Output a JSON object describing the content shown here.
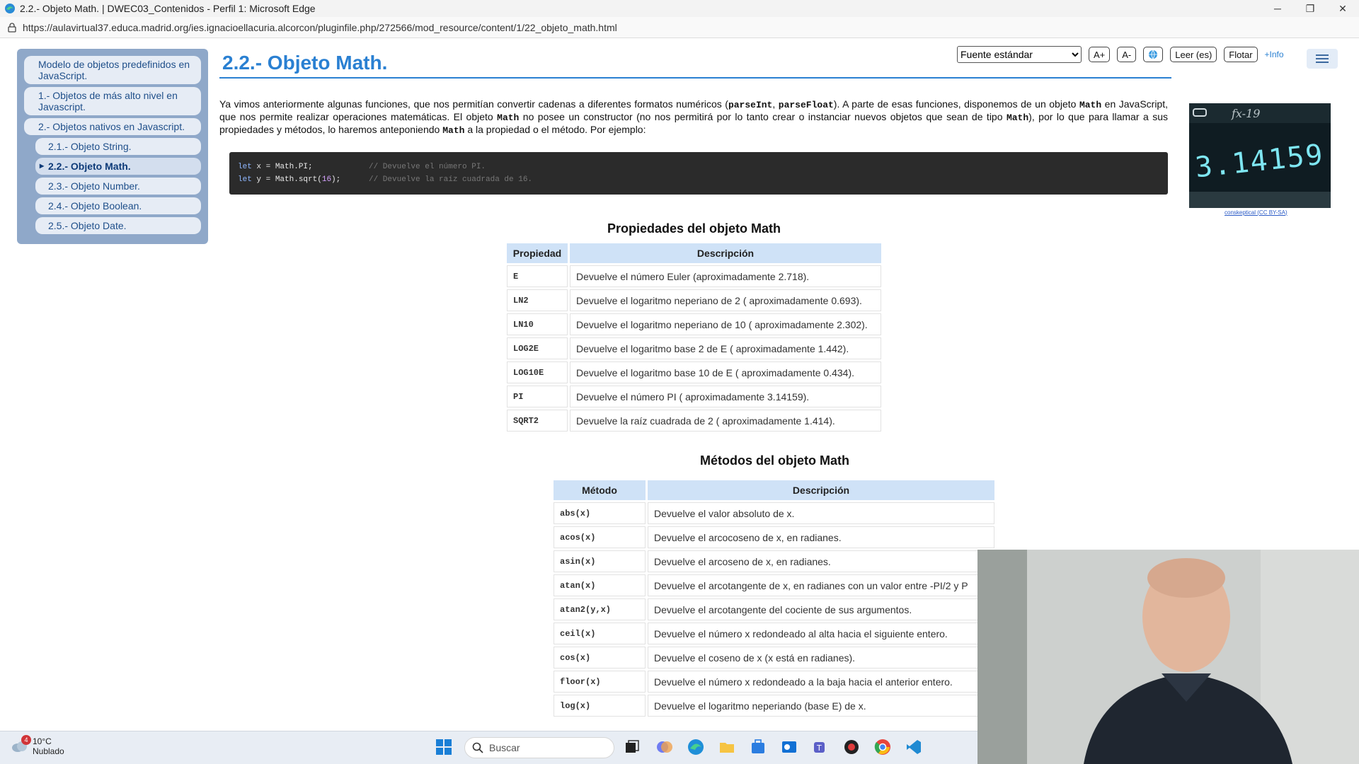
{
  "window": {
    "title": "2.2.- Objeto Math. | DWEC03_Contenidos - Perfil 1: Microsoft Edge",
    "url": "https://aulavirtual37.educa.madrid.org/ies.ignacioellacuria.alcorcon/pluginfile.php/272566/mod_resource/content/1/22_objeto_math.html",
    "minimize": "─",
    "restore": "❐",
    "close": "✕"
  },
  "sidebar": {
    "items": [
      {
        "label": "Modelo de objetos predefinidos en JavaScript."
      },
      {
        "label": "1.- Objetos de más alto nivel en Javascript."
      },
      {
        "label": "2.- Objetos nativos en Javascript."
      },
      {
        "label": "2.1.- Objeto String."
      },
      {
        "label": "2.2.- Objeto Math."
      },
      {
        "label": "2.3.- Objeto Number."
      },
      {
        "label": "2.4.- Objeto Boolean."
      },
      {
        "label": "2.5.- Objeto Date."
      }
    ]
  },
  "toolbar": {
    "font_select": "Fuente estándar",
    "a_plus": "A+",
    "a_minus": "A-",
    "read": "Leer (es)",
    "float": "Flotar",
    "info": "+Info"
  },
  "page": {
    "title": "2.2.- Objeto Math.",
    "intro": {
      "p1": "Ya vimos anteriormente algunas funciones, que nos permitían convertir cadenas a diferentes formatos numéricos (",
      "c1": "parseInt",
      "p2": ", ",
      "c2": "parseFloat",
      "p3": "). A parte de esas funciones, disponemos de un objeto ",
      "c3": "Math",
      "p4": " en JavaScript, que nos permite realizar operaciones matemáticas. El objeto ",
      "c4": "Math",
      "p5": " no posee un constructor (no nos permitirá por lo tanto crear o instanciar nuevos objetos que sean de tipo ",
      "c5": "Math",
      "p6": "), por lo que para llamar a sus propiedades y métodos, lo haremos anteponiendo ",
      "c6": "Math",
      "p7": " a la propiedad o el método. Por ejemplo:"
    },
    "code": {
      "l1_kw": "let",
      "l1_rest": " x = Math.PI;",
      "l1_comment": "// Devuelve el número PI.",
      "l2_kw": "let",
      "l2_a": " y = Math.sqrt(",
      "l2_num": "16",
      "l2_b": ");",
      "l2_comment": "// Devuelve la raíz cuadrada de 16."
    },
    "image_caption": {
      "author": "conskeptical",
      "sep": " (",
      "license": "CC BY-SA",
      "end": ")"
    }
  },
  "properties": {
    "heading": "Propiedades del objeto Math",
    "headers": [
      "Propiedad",
      "Descripción"
    ],
    "rows": [
      {
        "name": "E",
        "desc": "Devuelve el número Euler (aproximadamente 2.718)."
      },
      {
        "name": "LN2",
        "desc": "Devuelve el logaritmo neperiano de 2 ( aproximadamente 0.693)."
      },
      {
        "name": "LN10",
        "desc": "Devuelve el logaritmo neperiano de 10 ( aproximadamente 2.302)."
      },
      {
        "name": "LOG2E",
        "desc": "Devuelve el logaritmo base 2 de E ( aproximadamente 1.442)."
      },
      {
        "name": "LOG10E",
        "desc": "Devuelve el logaritmo base 10 de E ( aproximadamente 0.434)."
      },
      {
        "name": "PI",
        "desc": "Devuelve el número PI ( aproximadamente 3.14159)."
      },
      {
        "name": "SQRT2",
        "desc": "Devuelve la raíz cuadrada de 2 ( aproximadamente 1.414)."
      }
    ]
  },
  "methods": {
    "heading": "Métodos del objeto Math",
    "headers": [
      "Método",
      "Descripción"
    ],
    "rows": [
      {
        "name": "abs(x)",
        "desc": "Devuelve el valor absoluto de x."
      },
      {
        "name": "acos(x)",
        "desc": "Devuelve el arcocoseno de x, en radianes."
      },
      {
        "name": "asin(x)",
        "desc": "Devuelve el arcoseno de x, en radianes."
      },
      {
        "name": "atan(x)",
        "desc": "Devuelve el arcotangente de x, en radianes con un valor entre -PI/2 y P"
      },
      {
        "name": "atan2(y,x)",
        "desc": "Devuelve el arcotangente del cociente de sus argumentos."
      },
      {
        "name": "ceil(x)",
        "desc": "Devuelve el número x redondeado al alta hacia el siguiente entero."
      },
      {
        "name": "cos(x)",
        "desc": "Devuelve el coseno de x (x está en radianes)."
      },
      {
        "name": "floor(x)",
        "desc": "Devuelve el número x redondeado a la baja hacia el anterior entero."
      },
      {
        "name": "log(x)",
        "desc": "Devuelve el logaritmo neperiando (base E) de x."
      }
    ]
  },
  "taskbar": {
    "weather_temp": "10°C",
    "weather_desc": "Nublado",
    "notif_count": "4",
    "search_label": "Buscar"
  }
}
